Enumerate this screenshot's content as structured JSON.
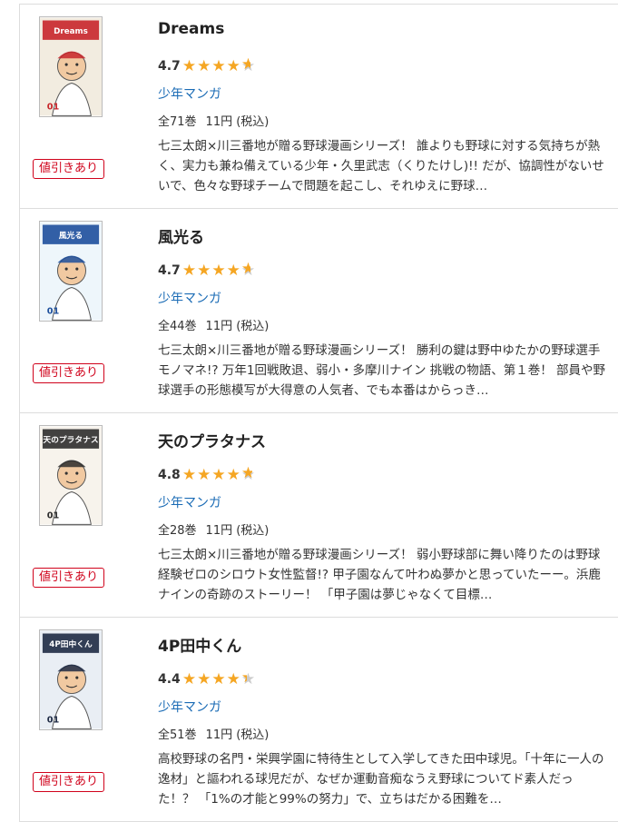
{
  "books": [
    {
      "title": "Dreams",
      "rating": 4.7,
      "rating_text": "4.7",
      "genre": "少年マンガ",
      "volumes": "全71巻",
      "price": "11円 (税込)",
      "discount": "値引きあり",
      "description": "七三太朗×川三番地が贈る野球漫画シリーズ！ 誰よりも野球に対する気持ちが熱く、実力も兼ね備えている少年・久里武志（くりたけし)!! だが、協調性がないせいで、色々な野球チームで問題を起こし、それゆえに野球…",
      "cover": {
        "bg": "#f2ece0",
        "accent": "#c8262b",
        "logo": "Dreams",
        "vol": "01"
      }
    },
    {
      "title": "風光る",
      "rating": 4.7,
      "rating_text": "4.7",
      "genre": "少年マンガ",
      "volumes": "全44巻",
      "price": "11円 (税込)",
      "discount": "値引きあり",
      "description": "七三太朗×川三番地が贈る野球漫画シリーズ！ 勝利の鍵は野中ゆたかの野球選手モノマネ!? 万年1回戦敗退、弱小・多摩川ナイン 挑戦の物語、第１巻！ 部員や野球選手の形態模写が大得意の人気者、でも本番はからっき…",
      "cover": {
        "bg": "#eef6fb",
        "accent": "#1d4f9c",
        "logo": "風光る",
        "vol": "01"
      }
    },
    {
      "title": "天のプラタナス",
      "rating": 4.8,
      "rating_text": "4.8",
      "genre": "少年マンガ",
      "volumes": "全28巻",
      "price": "11円 (税込)",
      "discount": "値引きあり",
      "description": "七三太朗×川三番地が贈る野球漫画シリーズ！ 弱小野球部に舞い降りたのは野球経験ゼロのシロウト女性監督!? 甲子園なんて叶わぬ夢かと思っていたーー。浜鹿ナインの奇跡のストーリー！ 「甲子園は夢じゃなくて目標…",
      "cover": {
        "bg": "#f7f3ec",
        "accent": "#2d2d2d",
        "logo": "天のプラタナス",
        "vol": "01"
      }
    },
    {
      "title": "4P田中くん",
      "rating": 4.4,
      "rating_text": "4.4",
      "genre": "少年マンガ",
      "volumes": "全51巻",
      "price": "11円 (税込)",
      "discount": "値引きあり",
      "description": "高校野球の名門・栄興学園に特待生として入学してきた田中球児。「十年に一人の逸材」と謳われる球児だが、なぜか運動音痴なうえ野球についてド素人だった！？ 「1%の才能と99%の努力」で、立ちはだかる困難を…",
      "cover": {
        "bg": "#e9eef4",
        "accent": "#1e2a44",
        "logo": "4P田中くん",
        "vol": "01"
      }
    }
  ],
  "colors": {
    "star": "#f5a623",
    "genre_link": "#1a6bb5",
    "discount": "#d0021b"
  },
  "icons": {
    "star": "star-icon"
  }
}
